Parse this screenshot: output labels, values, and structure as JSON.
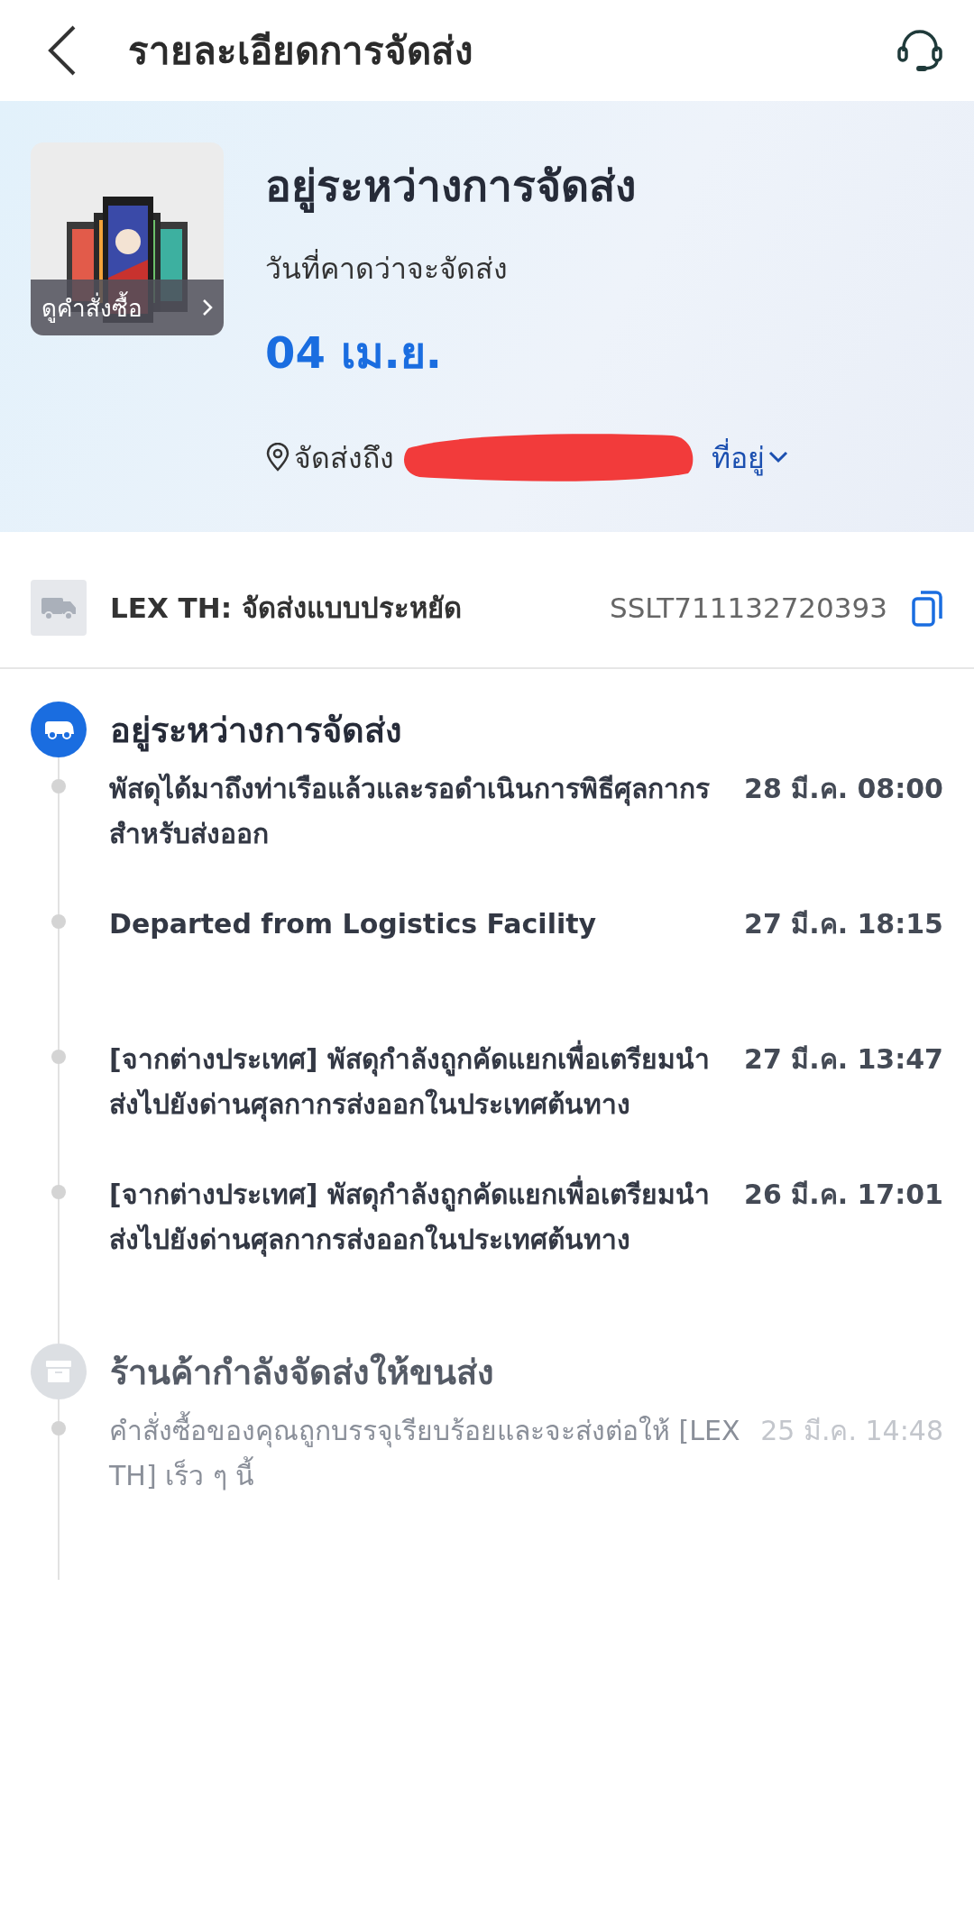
{
  "header": {
    "title": "รายละเอียดการจัดส่ง"
  },
  "summary": {
    "order_button": "ดูคำสั่งซื้อ",
    "status": "อยู่ระหว่างการจัดส่ง",
    "eta_label": "วันที่คาดว่าจะจัดส่ง",
    "eta_date": "04 เม.ย.",
    "ship_to_label": "จัดส่งถึง",
    "redacted": true,
    "address_link": "ที่อยู่"
  },
  "carrier": {
    "name": "LEX TH: จัดส่งแบบประหยัด",
    "tracking_number": "SSLT711132720393"
  },
  "timeline": [
    {
      "kind": "truck",
      "active": true,
      "title": "อยู่ระหว่างการจัดส่ง",
      "events": [
        {
          "text": "พัสดุได้มาถึงท่าเรือแล้วและรอดำเนินการพิธีศุลกากรสำหรับส่งออก",
          "time": "28 มี.ค. 08:00"
        },
        {
          "text": "Departed from Logistics Facility",
          "time": "27 มี.ค. 18:15"
        },
        {
          "text": "[จากต่างประเทศ] พัสดุกำลังถูกคัดแยกเพื่อเตรียมนำส่งไปยังด่านศุลกากรส่งออกในประเทศต้นทาง",
          "time": "27 มี.ค. 13:47"
        },
        {
          "text": "[จากต่างประเทศ] พัสดุกำลังถูกคัดแยกเพื่อเตรียมนำส่งไปยังด่านศุลกากรส่งออกในประเทศต้นทาง",
          "time": "26 มี.ค. 17:01"
        }
      ]
    },
    {
      "kind": "box",
      "active": false,
      "title": "ร้านค้ากำลังจัดส่งให้ขนส่ง",
      "events": [
        {
          "text": "คำสั่งซื้อของคุณถูกบรรจุเรียบร้อยและจะส่งต่อให้ [LEX TH] เร็ว ๆ นี้",
          "time": "25 มี.ค. 14:48"
        }
      ]
    }
  ]
}
